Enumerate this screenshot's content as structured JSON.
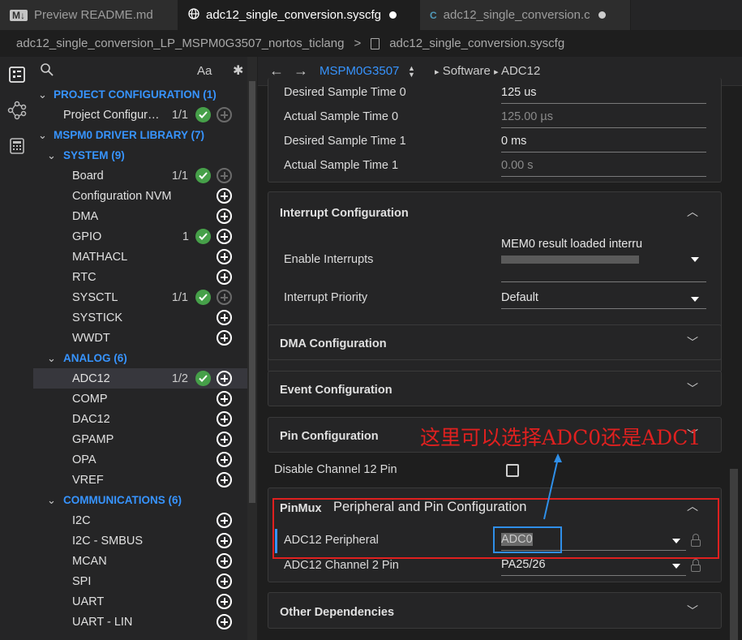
{
  "tabs": [
    {
      "icon": "M↓",
      "label": "Preview README.md"
    },
    {
      "icon": "globe",
      "label": "adc12_single_conversion.syscfg"
    },
    {
      "icon": "C",
      "label": "adc12_single_conversion.c"
    }
  ],
  "breadcrumb": {
    "project": "adc12_single_conversion_LP_MSPM0G3507_nortos_ticlang",
    "separator": ">",
    "file": "adc12_single_conversion.syscfg"
  },
  "left_panel": {
    "search_placeholder": "",
    "case_label": "Aa",
    "filter_label": "✱",
    "rows": [
      {
        "type": "category",
        "label": "PROJECT CONFIGURATION (1)"
      },
      {
        "type": "item",
        "label": "Project Configur…",
        "count": "1/1",
        "check": true,
        "add_disabled": true
      },
      {
        "type": "category",
        "label": "MSPM0 DRIVER LIBRARY (7)"
      },
      {
        "type": "subcategory",
        "label": "SYSTEM (9)"
      },
      {
        "type": "item",
        "label": "Board",
        "count": "1/1",
        "check": true,
        "add_disabled": true
      },
      {
        "type": "item",
        "label": "Configuration NVM",
        "count": "",
        "check": false
      },
      {
        "type": "item",
        "label": "DMA",
        "count": "",
        "check": false
      },
      {
        "type": "item",
        "label": "GPIO",
        "count": "1",
        "check": true
      },
      {
        "type": "item",
        "label": "MATHACL",
        "count": "",
        "check": false
      },
      {
        "type": "item",
        "label": "RTC",
        "count": "",
        "check": false
      },
      {
        "type": "item",
        "label": "SYSCTL",
        "count": "1/1",
        "check": true,
        "add_disabled": true
      },
      {
        "type": "item",
        "label": "SYSTICK",
        "count": "",
        "check": false
      },
      {
        "type": "item",
        "label": "WWDT",
        "count": "",
        "check": false
      },
      {
        "type": "subcategory",
        "label": "ANALOG (6)"
      },
      {
        "type": "item",
        "label": "ADC12",
        "count": "1/2",
        "check": true,
        "selected": true
      },
      {
        "type": "item",
        "label": "COMP",
        "count": "",
        "check": false
      },
      {
        "type": "item",
        "label": "DAC12",
        "count": "",
        "check": false
      },
      {
        "type": "item",
        "label": "GPAMP",
        "count": "",
        "check": false
      },
      {
        "type": "item",
        "label": "OPA",
        "count": "",
        "check": false
      },
      {
        "type": "item",
        "label": "VREF",
        "count": "",
        "check": false
      },
      {
        "type": "subcategory",
        "label": "COMMUNICATIONS (6)"
      },
      {
        "type": "item",
        "label": "I2C",
        "count": "",
        "check": false
      },
      {
        "type": "item",
        "label": "I2C - SMBUS",
        "count": "",
        "check": false
      },
      {
        "type": "item",
        "label": "MCAN",
        "count": "",
        "check": false
      },
      {
        "type": "item",
        "label": "SPI",
        "count": "",
        "check": false
      },
      {
        "type": "item",
        "label": "UART",
        "count": "",
        "check": false
      },
      {
        "type": "item",
        "label": "UART - LIN",
        "count": "",
        "check": false
      }
    ]
  },
  "right_panel": {
    "device": "MSPM0G3507",
    "path1": "Software",
    "path_sep": "▸",
    "path2": "ADC12",
    "sample_times": [
      {
        "label": "Desired Sample Time 0",
        "value": "125 us",
        "readonly": false
      },
      {
        "label": "Actual Sample Time 0",
        "value": "125.00 µs",
        "readonly": true
      },
      {
        "label": "Desired Sample Time 1",
        "value": "0 ms",
        "readonly": false
      },
      {
        "label": "Actual Sample Time 1",
        "value": "0.00 s",
        "readonly": true
      }
    ],
    "interrupt": {
      "title": "Interrupt Configuration",
      "enable_label": "Enable Interrupts",
      "enable_value": "MEM0 result loaded interru",
      "priority_label": "Interrupt Priority",
      "priority_value": "Default"
    },
    "dma_title": "DMA Configuration",
    "event_title": "Event Configuration",
    "pin_title": "Pin Configuration",
    "disable_ch_label": "Disable Channel 12 Pin",
    "pinmux": {
      "title": "PinMux",
      "subtitle": "Peripheral and Pin Configuration",
      "peripheral_label": "ADC12 Peripheral",
      "peripheral_value": "ADC0",
      "pin_label": "ADC12 Channel 2 Pin",
      "pin_value": "PA25/26"
    },
    "other_title": "Other Dependencies"
  },
  "annotation": {
    "text": "这里可以选择ADC0还是ADC1",
    "color": "#e0201f"
  }
}
